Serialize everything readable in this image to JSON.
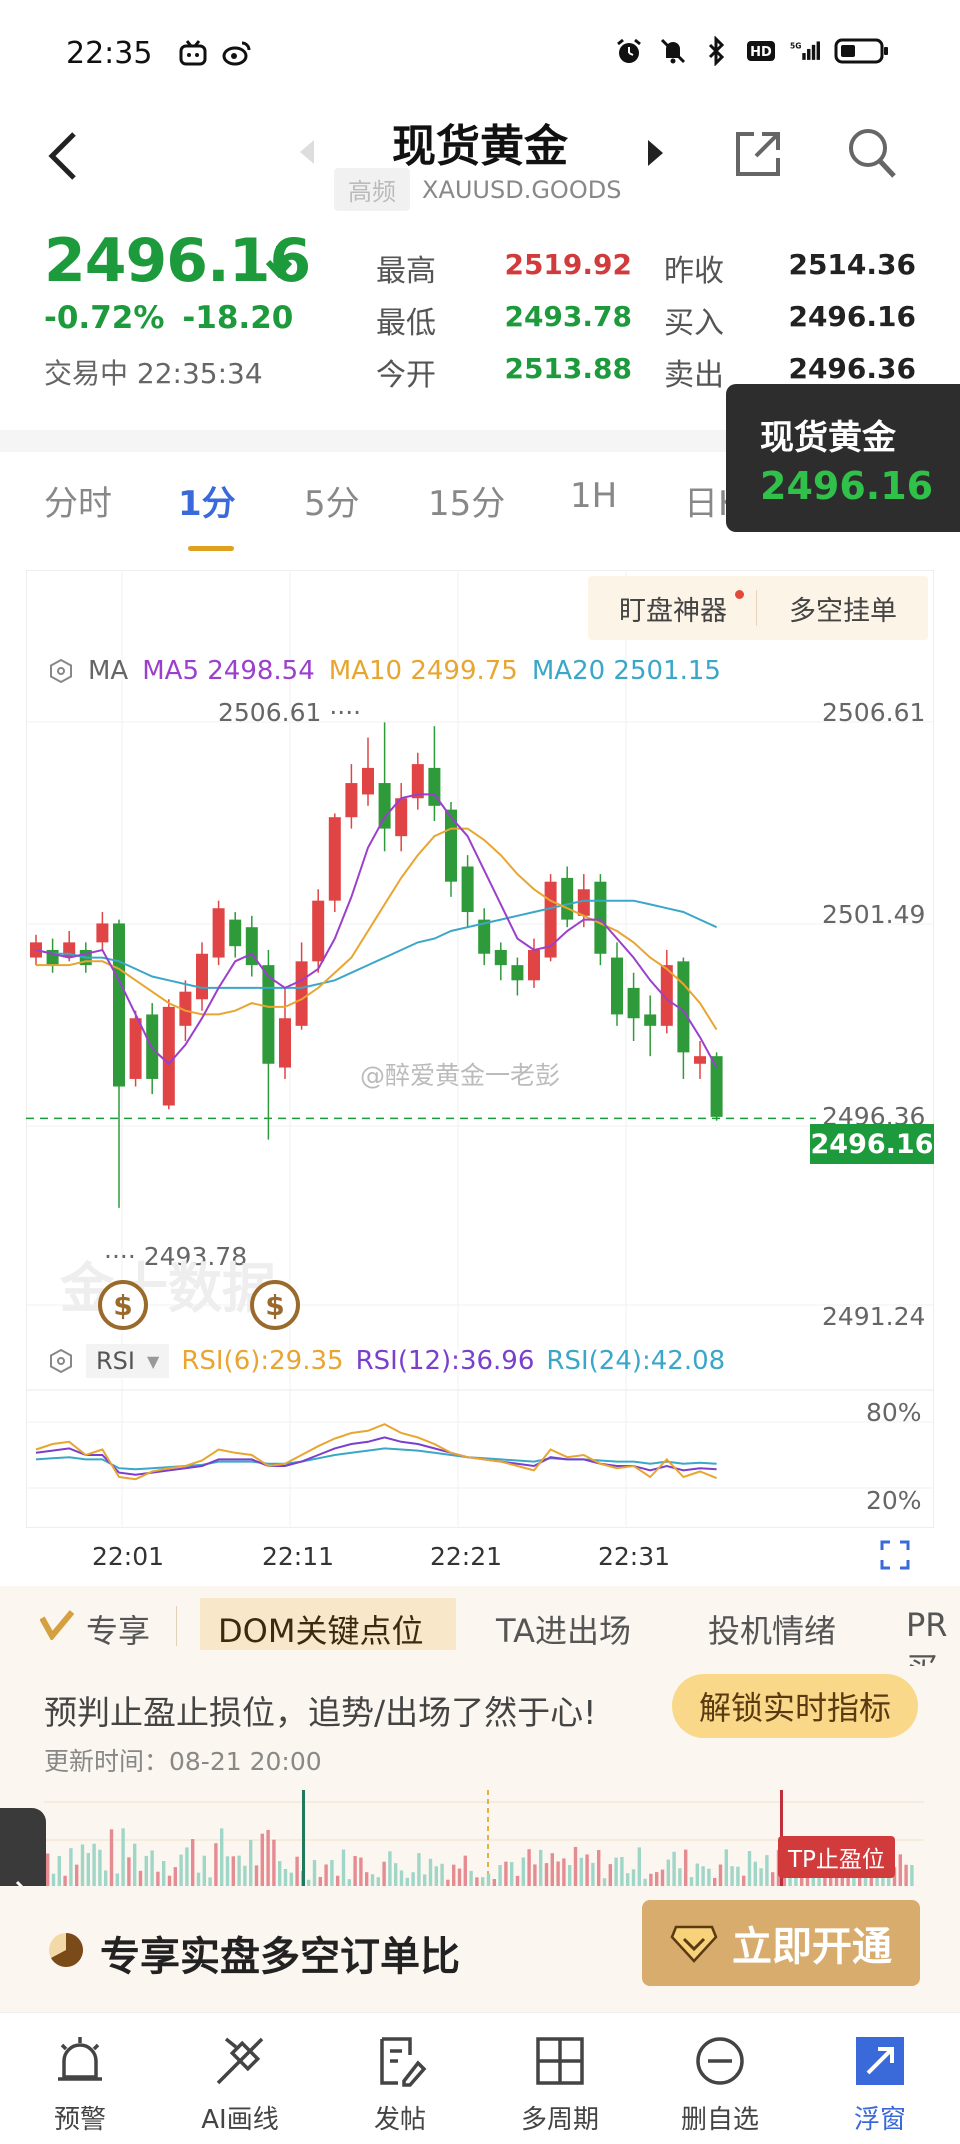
{
  "status_bar": {
    "time": "22:35",
    "network": "5G"
  },
  "header": {
    "title": "现货黄金",
    "badge": "高频",
    "symbol": "XAUUSD.GOODS"
  },
  "quote": {
    "price": "2496.16",
    "change_pct": "-0.72%",
    "change_abs": "-18.20",
    "status": "交易中 22:35:34",
    "high_label": "最高",
    "high": "2519.92",
    "low_label": "最低",
    "low": "2493.78",
    "open_label": "今开",
    "open": "2513.88",
    "prev_label": "昨收",
    "prev": "2514.36",
    "bid_label": "买入",
    "bid": "2496.16",
    "ask_label": "卖出",
    "ask": "2496.36"
  },
  "float_window": {
    "title": "现货黄金",
    "price": "2496.16"
  },
  "tabs": [
    "分时",
    "1分",
    "5分",
    "15分",
    "1H",
    "日K"
  ],
  "chart_buttons": {
    "monitor": "盯盘神器",
    "orders": "多空挂单"
  },
  "ma": {
    "label": "MA",
    "ma5": "MA5 2498.54",
    "ma10": "MA10 2499.75",
    "ma20": "MA20 2501.15",
    "colors": {
      "ma5": "#9b3fcc",
      "ma10": "#e8a530",
      "ma20": "#3ba7c8"
    }
  },
  "rsi": {
    "select": "RSI",
    "rsi6": "RSI(6):29.35",
    "rsi12": "RSI(12):36.96",
    "rsi24": "RSI(24):42.08",
    "axis": [
      "80%",
      "20%"
    ]
  },
  "chart_labels": {
    "high_marker": "2506.61 ····",
    "low_marker": "···· 2493.78",
    "last_price": "2496.16",
    "watermark": "@醉爱黄金一老彭",
    "brand": "金十数据",
    "dollar": "$"
  },
  "chart_data": {
    "type": "candlestick",
    "price_axis": [
      "2506.61",
      "2501.49",
      "2496.36",
      "2491.24"
    ],
    "time_axis": [
      "22:01",
      "22:11",
      "22:21",
      "22:31"
    ],
    "ylim": [
      2491.24,
      2506.61
    ],
    "candles": [
      {
        "o": 2500.4,
        "c": 2500.8,
        "h": 2501.0,
        "l": 2500.2
      },
      {
        "o": 2500.6,
        "c": 2500.2,
        "h": 2500.9,
        "l": 2500.0
      },
      {
        "o": 2500.4,
        "c": 2500.8,
        "h": 2501.1,
        "l": 2500.3
      },
      {
        "o": 2500.6,
        "c": 2500.2,
        "h": 2500.8,
        "l": 2500.0
      },
      {
        "o": 2500.8,
        "c": 2501.3,
        "h": 2501.6,
        "l": 2500.6
      },
      {
        "o": 2501.3,
        "c": 2497.0,
        "h": 2501.4,
        "l": 2493.8
      },
      {
        "o": 2497.2,
        "c": 2498.8,
        "h": 2499.0,
        "l": 2497.0
      },
      {
        "o": 2498.9,
        "c": 2497.2,
        "h": 2499.2,
        "l": 2496.8
      },
      {
        "o": 2496.5,
        "c": 2499.1,
        "h": 2499.3,
        "l": 2496.4
      },
      {
        "o": 2498.6,
        "c": 2499.5,
        "h": 2499.8,
        "l": 2498.2
      },
      {
        "o": 2499.3,
        "c": 2500.5,
        "h": 2500.8,
        "l": 2499.0
      },
      {
        "o": 2500.4,
        "c": 2501.7,
        "h": 2501.9,
        "l": 2500.2
      },
      {
        "o": 2501.4,
        "c": 2500.7,
        "h": 2501.6,
        "l": 2500.4
      },
      {
        "o": 2501.2,
        "c": 2500.2,
        "h": 2501.5,
        "l": 2499.9
      },
      {
        "o": 2500.2,
        "c": 2497.6,
        "h": 2500.6,
        "l": 2495.6
      },
      {
        "o": 2497.5,
        "c": 2498.8,
        "h": 2499.6,
        "l": 2497.2
      },
      {
        "o": 2498.6,
        "c": 2500.3,
        "h": 2500.8,
        "l": 2498.5
      },
      {
        "o": 2500.3,
        "c": 2501.9,
        "h": 2502.2,
        "l": 2500.0
      },
      {
        "o": 2501.9,
        "c": 2504.1,
        "h": 2504.2,
        "l": 2501.6
      },
      {
        "o": 2504.1,
        "c": 2505.0,
        "h": 2505.5,
        "l": 2503.8
      },
      {
        "o": 2504.7,
        "c": 2505.4,
        "h": 2506.2,
        "l": 2504.4
      },
      {
        "o": 2505.0,
        "c": 2503.8,
        "h": 2506.6,
        "l": 2503.2
      },
      {
        "o": 2503.6,
        "c": 2504.6,
        "h": 2505.0,
        "l": 2503.2
      },
      {
        "o": 2504.6,
        "c": 2505.5,
        "h": 2505.8,
        "l": 2504.3
      },
      {
        "o": 2505.4,
        "c": 2504.4,
        "h": 2506.5,
        "l": 2504.0
      },
      {
        "o": 2504.3,
        "c": 2502.4,
        "h": 2504.5,
        "l": 2502.0
      },
      {
        "o": 2502.8,
        "c": 2501.6,
        "h": 2503.1,
        "l": 2501.2
      },
      {
        "o": 2501.4,
        "c": 2500.5,
        "h": 2501.7,
        "l": 2500.2
      },
      {
        "o": 2500.6,
        "c": 2500.2,
        "h": 2500.8,
        "l": 2499.8
      },
      {
        "o": 2500.2,
        "c": 2499.8,
        "h": 2500.4,
        "l": 2499.4
      },
      {
        "o": 2499.8,
        "c": 2500.6,
        "h": 2500.9,
        "l": 2499.6
      },
      {
        "o": 2500.4,
        "c": 2502.4,
        "h": 2502.6,
        "l": 2500.3
      },
      {
        "o": 2502.5,
        "c": 2501.4,
        "h": 2502.8,
        "l": 2501.2
      },
      {
        "o": 2501.5,
        "c": 2502.2,
        "h": 2502.6,
        "l": 2501.2
      },
      {
        "o": 2502.4,
        "c": 2500.5,
        "h": 2502.6,
        "l": 2500.2
      },
      {
        "o": 2500.4,
        "c": 2498.9,
        "h": 2500.8,
        "l": 2498.6
      },
      {
        "o": 2499.6,
        "c": 2498.8,
        "h": 2500.0,
        "l": 2498.2
      },
      {
        "o": 2498.9,
        "c": 2498.6,
        "h": 2499.4,
        "l": 2497.8
      },
      {
        "o": 2498.6,
        "c": 2500.2,
        "h": 2500.6,
        "l": 2498.4
      },
      {
        "o": 2500.3,
        "c": 2497.9,
        "h": 2500.4,
        "l": 2497.2
      },
      {
        "o": 2497.6,
        "c": 2497.8,
        "h": 2498.2,
        "l": 2497.2
      },
      {
        "o": 2497.8,
        "c": 2496.2,
        "h": 2497.9,
        "l": 2496.1
      }
    ],
    "ma5": [
      2500.6,
      2500.5,
      2500.4,
      2500.5,
      2500.6,
      2499.8,
      2498.9,
      2498.0,
      2497.6,
      2498.1,
      2498.8,
      2499.6,
      2500.3,
      2500.5,
      2499.9,
      2499.6,
      2499.8,
      2500.1,
      2500.9,
      2502.0,
      2503.3,
      2504.1,
      2504.6,
      2504.7,
      2504.7,
      2504.1,
      2503.6,
      2502.7,
      2501.8,
      2500.9,
      2500.6,
      2500.7,
      2501.1,
      2501.4,
      2501.4,
      2500.9,
      2500.4,
      2499.8,
      2499.3,
      2499.0,
      2498.3,
      2497.5
    ],
    "ma10": [
      2500.2,
      2500.2,
      2500.2,
      2500.3,
      2500.3,
      2500.1,
      2499.8,
      2499.5,
      2499.2,
      2499.0,
      2498.9,
      2498.9,
      2499.0,
      2499.2,
      2499.1,
      2499.1,
      2499.3,
      2499.6,
      2500.0,
      2500.4,
      2501.1,
      2501.8,
      2502.5,
      2503.1,
      2503.6,
      2503.8,
      2503.8,
      2503.5,
      2503.1,
      2502.6,
      2502.2,
      2501.9,
      2501.7,
      2501.5,
      2501.3,
      2501.1,
      2500.8,
      2500.4,
      2500.1,
      2499.7,
      2499.2,
      2498.5
    ],
    "ma20": [
      2500.6,
      2500.5,
      2500.5,
      2500.4,
      2500.4,
      2500.3,
      2500.1,
      2499.9,
      2499.8,
      2499.7,
      2499.6,
      2499.6,
      2499.6,
      2499.6,
      2499.6,
      2499.6,
      2499.6,
      2499.7,
      2499.8,
      2500.0,
      2500.2,
      2500.4,
      2500.6,
      2500.8,
      2500.9,
      2501.1,
      2501.2,
      2501.3,
      2501.4,
      2501.5,
      2501.6,
      2501.7,
      2501.8,
      2501.9,
      2501.9,
      2501.9,
      2501.9,
      2501.8,
      2501.7,
      2501.6,
      2501.4,
      2501.2
    ],
    "rsi6": [
      55,
      60,
      62,
      50,
      55,
      30,
      28,
      35,
      38,
      40,
      45,
      55,
      52,
      50,
      40,
      42,
      50,
      58,
      65,
      70,
      72,
      78,
      70,
      66,
      60,
      52,
      48,
      46,
      44,
      40,
      36,
      55,
      48,
      50,
      42,
      38,
      40,
      30,
      46,
      30,
      35,
      29
    ],
    "rsi12": [
      52,
      54,
      56,
      50,
      50,
      34,
      32,
      34,
      36,
      38,
      40,
      46,
      46,
      46,
      40,
      40,
      44,
      50,
      56,
      60,
      62,
      66,
      62,
      60,
      56,
      52,
      48,
      46,
      44,
      42,
      40,
      48,
      46,
      46,
      42,
      40,
      40,
      36,
      40,
      36,
      38,
      37
    ],
    "rsi24": [
      46,
      47,
      48,
      46,
      46,
      38,
      37,
      38,
      39,
      40,
      41,
      44,
      44,
      44,
      42,
      42,
      44,
      47,
      50,
      52,
      54,
      56,
      55,
      54,
      52,
      50,
      48,
      47,
      46,
      45,
      44,
      47,
      46,
      46,
      45,
      44,
      44,
      42,
      44,
      42,
      43,
      42
    ]
  },
  "features": {
    "exclusive": "专享",
    "items": [
      "DOM关键点位",
      "TA进出场",
      "投机情绪",
      "PR买"
    ]
  },
  "panel": {
    "text": "预判止盈止损位，追势/出场了然于心!",
    "update": "更新时间：08-21 20:00",
    "unlock": "解锁实时指标",
    "tp_tag": "TP止盈位"
  },
  "promo": {
    "text": "专享实盘多空订单比",
    "open": "立即开通"
  },
  "bottom_nav": [
    {
      "label": "预警",
      "icon": "bell-icon"
    },
    {
      "label": "AI画线",
      "icon": "draw-line-icon"
    },
    {
      "label": "发帖",
      "icon": "post-icon"
    },
    {
      "label": "多周期",
      "icon": "grid-icon"
    },
    {
      "label": "删自选",
      "icon": "minus-circle-icon"
    },
    {
      "label": "浮窗",
      "icon": "float-window-icon"
    }
  ]
}
